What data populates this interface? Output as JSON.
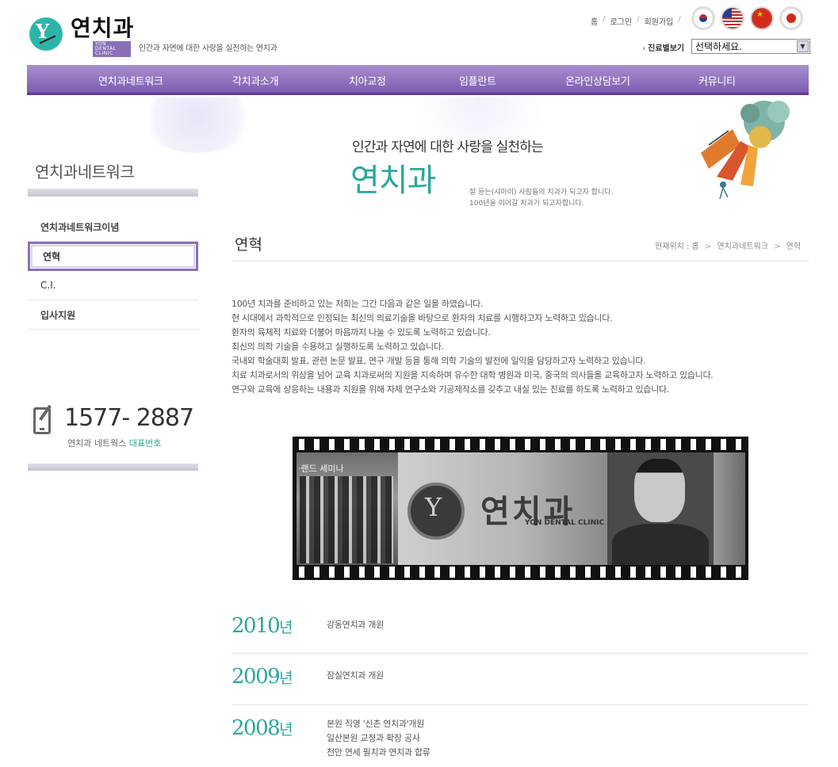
{
  "header": {
    "logo_text": "연치과",
    "logo_tag": "YON DENTAL CLINIC",
    "slogan": "인간과 자연에 대한 사랑을 실천하는 연치과",
    "top_links": [
      "홈",
      "로그인",
      "회원가입"
    ],
    "flags": [
      "korean-flag-icon",
      "usa-flag-icon",
      "china-flag-icon",
      "japan-flag-icon"
    ],
    "clinic_select_label": "진료별보기",
    "clinic_select_value": "선택하세요."
  },
  "nav": {
    "items": [
      "연치과네트워크",
      "각치과소개",
      "치아교정",
      "임플란트",
      "온라인상담보기",
      "커뮤니티"
    ]
  },
  "hero": {
    "subtitle": "인간과 자연에 대한 사랑을 실천하는",
    "title": "연치과",
    "desc_line1": "잘 듣는(샤마이) 사람들의 치과가 되고자 합니다.",
    "desc_line2": "100년을 이어갈 치과가 되고자합니다."
  },
  "sidebar": {
    "title": "연치과네트워크",
    "items": [
      "연치과네트워크이념",
      "연혁",
      "C.I.",
      "입사지원"
    ],
    "phone_number": "1577- 2887",
    "phone_caption_prefix": "연치과 네트웍스",
    "phone_caption_highlight": "대표번호"
  },
  "content": {
    "page_title": "연혁",
    "breadcrumb": [
      "현재위치 : 홈",
      "연치과네트워크",
      "연혁"
    ],
    "intro_lines": [
      "100년 치과를 준비하고 있는 저희는 그간 다음과 같은 일을 하였습니다.",
      "현 시대에서 과학적으로 인정되는 최신의 의료기술을 바탕으로 환자의 치료를 시행하고자 노력하고 있습니다.",
      "환자의 육체적 치료와 더불어 마음까지 나눌 수 있도록 노력하고 있습니다.",
      "최신의 의학 기술을 수용하고 실행하도록 노력하고 있습니다.",
      "국내외 학술대회 발표, 관련 논문 발표, 연구 개발 등을 통해 의학 기술의 발전에 일익을 담당하고자 노력하고 있습니다.",
      "치료 치과로서의 위상을 넘어 교육 치과로써의 지원을 지속하며 유수한 대학 병원과 미국, 중국의 의사들을 교육하고자 노력하고 있습니다.",
      "연구와 교육에 상응하는 내용과 지원을 위해 자체 연구소와 기공제작소를 갖추고 내실 있는 진료를 하도록 노력하고 있습니다."
    ],
    "film_caption": "·랜드 세미나",
    "film_logo_word": "연치과",
    "film_logo_eng": "YON DENTAL CLINIC",
    "history": [
      {
        "year": "2010",
        "unit": "년",
        "events": [
          "강동연치과 개원"
        ]
      },
      {
        "year": "2009",
        "unit": "년",
        "events": [
          "잠실연치과 개원"
        ]
      },
      {
        "year": "2008",
        "unit": "년",
        "events": [
          "본원 직영 '신촌 연치과'개원",
          "일산본원 교정과 확장 공사",
          "천안 연세 필치과 연치과 합류"
        ]
      }
    ]
  }
}
